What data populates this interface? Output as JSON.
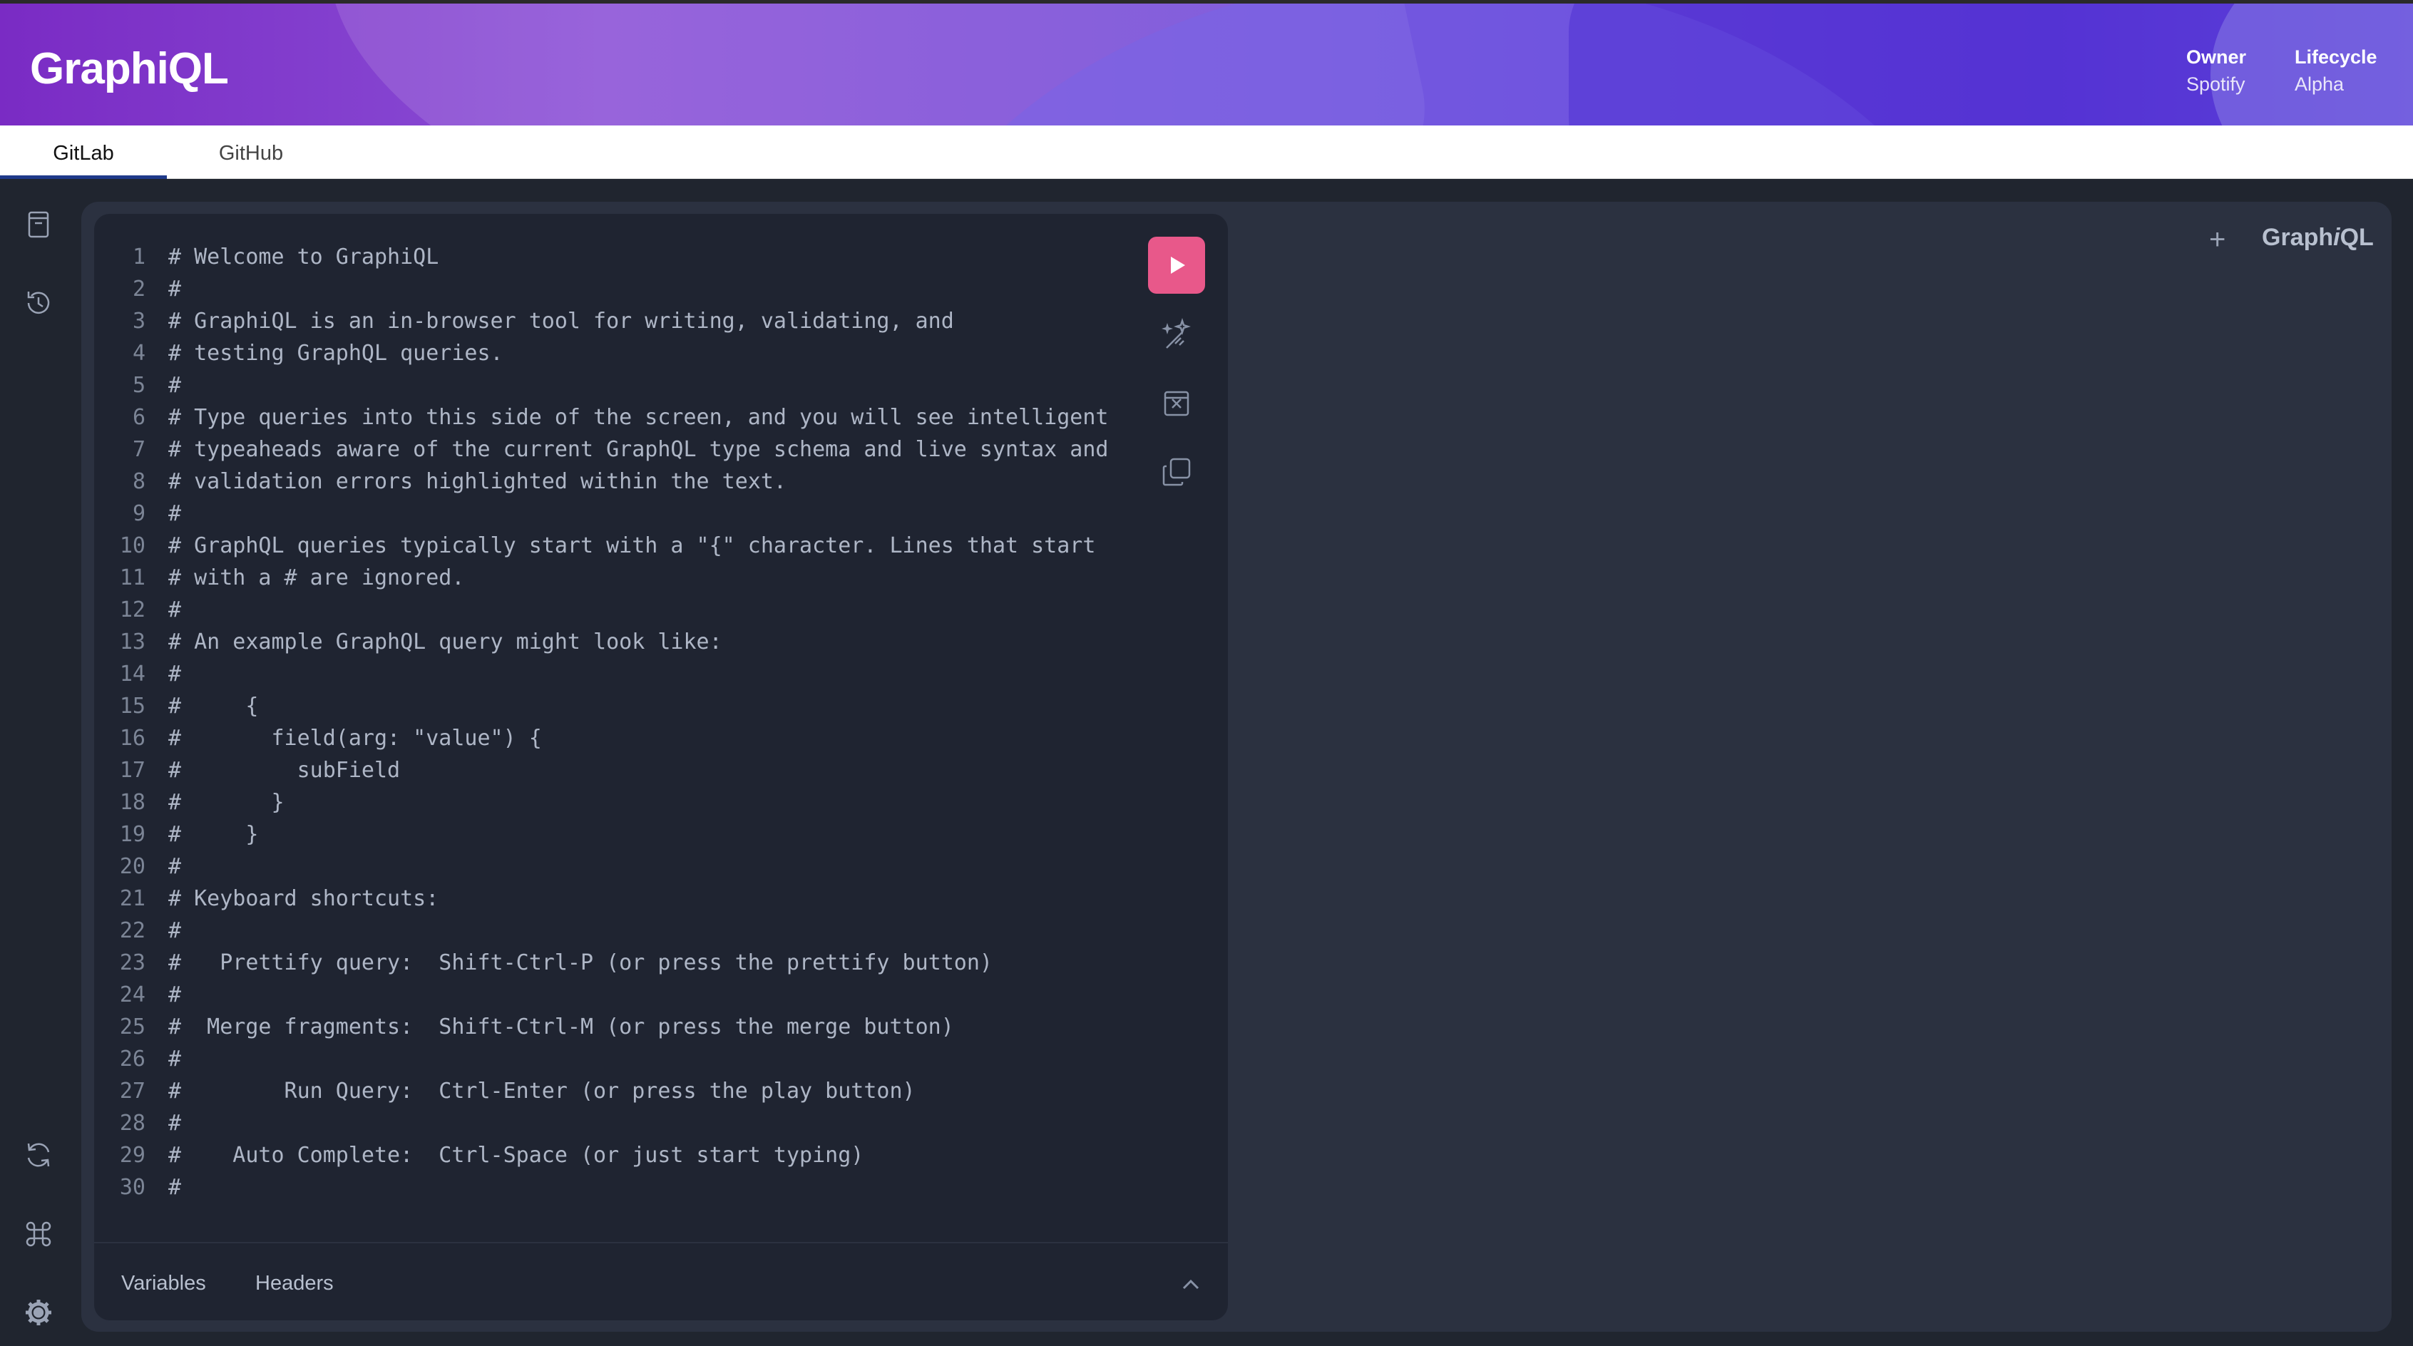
{
  "header": {
    "title": "GraphiQL",
    "owner_label": "Owner",
    "owner_value": "Spotify",
    "lifecycle_label": "Lifecycle",
    "lifecycle_value": "Alpha"
  },
  "tabs": [
    {
      "label": "GitLab",
      "active": true
    },
    {
      "label": "GitHub",
      "active": false
    }
  ],
  "sidebar_icons": [
    "docs-icon",
    "history-icon",
    "refetch-schema-icon",
    "shortcuts-icon",
    "settings-icon"
  ],
  "editor": {
    "lines": [
      {
        "n": "1",
        "t": "# Welcome to GraphiQL"
      },
      {
        "n": "2",
        "t": "#"
      },
      {
        "n": "3",
        "t": "# GraphiQL is an in-browser tool for writing, validating, and"
      },
      {
        "n": "4",
        "t": "# testing GraphQL queries."
      },
      {
        "n": "5",
        "t": "#"
      },
      {
        "n": "6",
        "t": "# Type queries into this side of the screen, and you will see intelligent"
      },
      {
        "n": "7",
        "t": "# typeaheads aware of the current GraphQL type schema and live syntax and"
      },
      {
        "n": "8",
        "t": "# validation errors highlighted within the text."
      },
      {
        "n": "9",
        "t": "#"
      },
      {
        "n": "10",
        "t": "# GraphQL queries typically start with a \"{\" character. Lines that start"
      },
      {
        "n": "11",
        "t": "# with a # are ignored."
      },
      {
        "n": "12",
        "t": "#"
      },
      {
        "n": "13",
        "t": "# An example GraphQL query might look like:"
      },
      {
        "n": "14",
        "t": "#"
      },
      {
        "n": "15",
        "t": "#     {"
      },
      {
        "n": "16",
        "t": "#       field(arg: \"value\") {"
      },
      {
        "n": "17",
        "t": "#         subField"
      },
      {
        "n": "18",
        "t": "#       }"
      },
      {
        "n": "19",
        "t": "#     }"
      },
      {
        "n": "20",
        "t": "#"
      },
      {
        "n": "21",
        "t": "# Keyboard shortcuts:"
      },
      {
        "n": "22",
        "t": "#"
      },
      {
        "n": "23",
        "t": "#   Prettify query:  Shift-Ctrl-P (or press the prettify button)"
      },
      {
        "n": "24",
        "t": "#"
      },
      {
        "n": "25",
        "t": "#  Merge fragments:  Shift-Ctrl-M (or press the merge button)"
      },
      {
        "n": "26",
        "t": "#"
      },
      {
        "n": "27",
        "t": "#        Run Query:  Ctrl-Enter (or press the play button)"
      },
      {
        "n": "28",
        "t": "#"
      },
      {
        "n": "29",
        "t": "#    Auto Complete:  Ctrl-Space (or just start typing)"
      },
      {
        "n": "30",
        "t": "#"
      }
    ]
  },
  "bottom_tabs": {
    "variables": "Variables",
    "headers": "Headers"
  },
  "right_panel": {
    "add_tab": "+",
    "brand_prefix": "Graph",
    "brand_italic": "i",
    "brand_suffix": "QL"
  },
  "colors": {
    "run_button": "#e8588a",
    "background": "#20252f",
    "panel": "#2b3140",
    "active_tab_underline": "#1f3a8a"
  }
}
